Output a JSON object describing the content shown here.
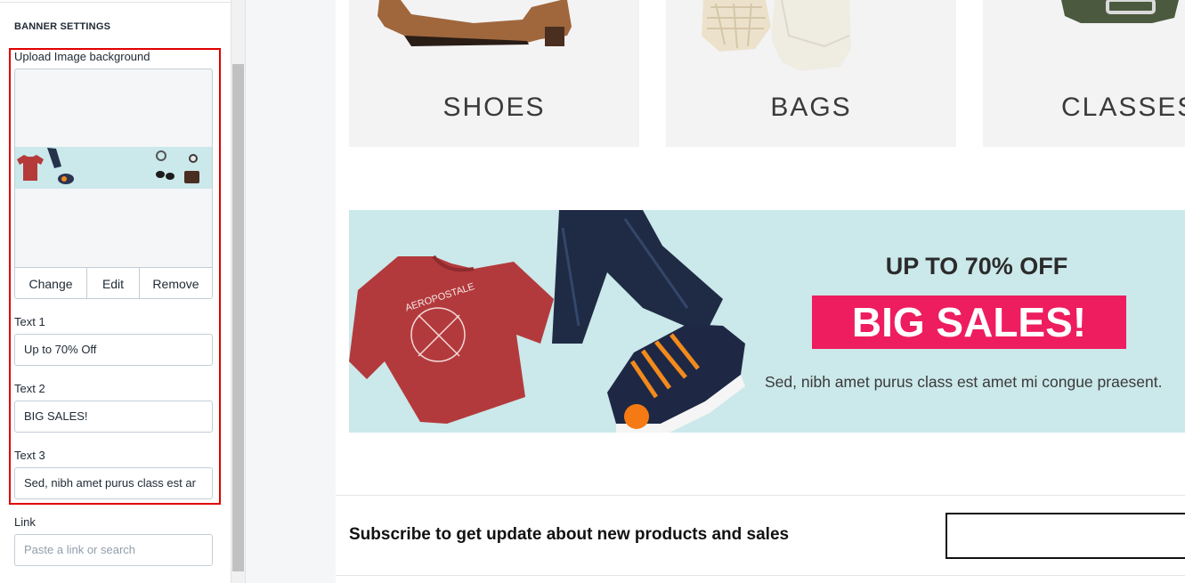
{
  "panel": {
    "heading": "BANNER SETTINGS",
    "upload": {
      "label": "Upload Image background",
      "change_label": "Change",
      "edit_label": "Edit",
      "remove_label": "Remove"
    },
    "text1": {
      "label": "Text 1",
      "value": "Up to 70% Off"
    },
    "text2": {
      "label": "Text 2",
      "value": "BIG SALES!"
    },
    "text3": {
      "label": "Text 3",
      "value": "Sed, nibh amet purus class est ar"
    },
    "link": {
      "label": "Link",
      "placeholder": "Paste a link or search"
    }
  },
  "preview": {
    "categories": [
      {
        "label": "SHOES"
      },
      {
        "label": "BAGS"
      },
      {
        "label": "CLASSES"
      }
    ],
    "banner": {
      "text1": "UP TO 70% OFF",
      "text2": "BIG SALES!",
      "text3": "Sed, nibh amet purus class est amet mi congue praesent.",
      "tshirt_print": "AEROPOSTALE"
    },
    "subscribe": {
      "text": "Subscribe to get update about new products and sales"
    }
  },
  "colors": {
    "highlight": "#e00000",
    "banner_bg": "#cbe8ea",
    "sale_badge": "#ee1d60"
  }
}
